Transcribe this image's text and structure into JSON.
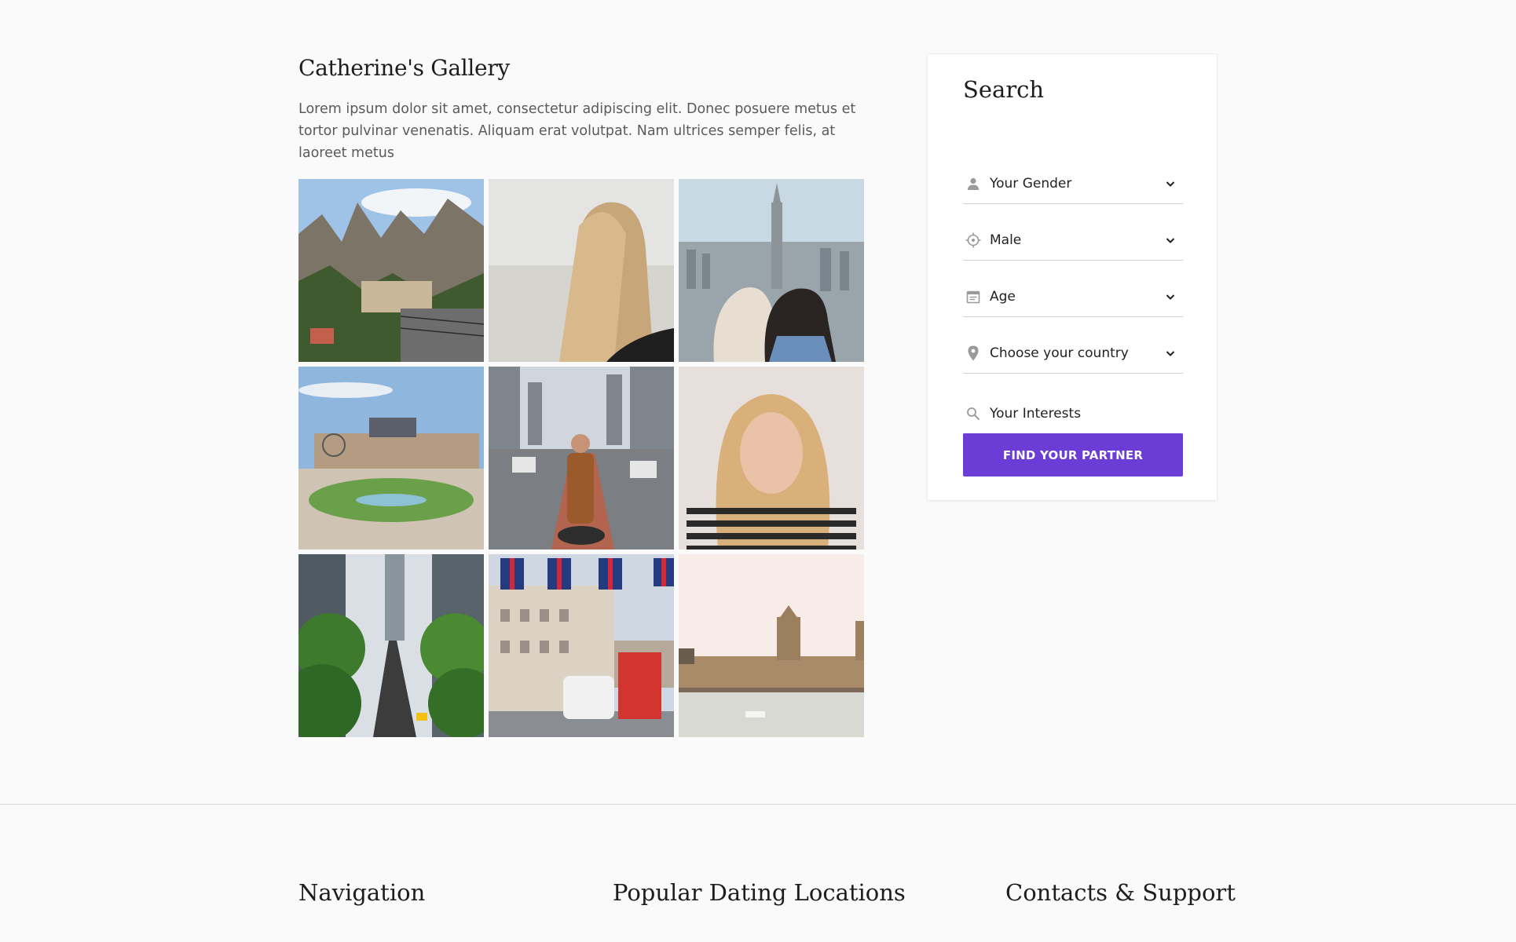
{
  "gallery": {
    "title": "Catherine's Gallery",
    "description": "Lorem ipsum dolor sit amet, consectetur adipiscing elit. Donec posuere metus et tortor pulvinar venenatis. Aliquam erat volutpat. Nam ultrices semper felis, at laoreet metus",
    "photos": [
      {
        "subject": "mountain monastery landscape"
      },
      {
        "subject": "portrait of woman with windblown hair"
      },
      {
        "subject": "friends on rooftop above city skyline"
      },
      {
        "subject": "palace and gardens with ferris wheel"
      },
      {
        "subject": "woman standing in city street bike lane"
      },
      {
        "subject": "portrait of blonde woman in striped top"
      },
      {
        "subject": "tree-lined city avenue with taxi"
      },
      {
        "subject": "street with union jack flags and double decker bus"
      },
      {
        "subject": "parliament building across the river"
      }
    ]
  },
  "search": {
    "title": "Search",
    "fields": {
      "gender": {
        "label": "Your Gender",
        "icon": "person-icon"
      },
      "seeking": {
        "label": "Male",
        "icon": "crosshair-icon"
      },
      "age": {
        "label": "Age",
        "icon": "calendar-icon"
      },
      "country": {
        "label": "Choose your country",
        "icon": "location-pin-icon"
      },
      "interests": {
        "placeholder": "Your Interests",
        "icon": "search-icon"
      }
    },
    "button_label": "FIND YOUR PARTNER",
    "accent_color": "#6c3cd6"
  },
  "footer": {
    "navigation_title": "Navigation",
    "locations_title": "Popular Dating Locations",
    "contacts_title": "Contacts & Support"
  }
}
